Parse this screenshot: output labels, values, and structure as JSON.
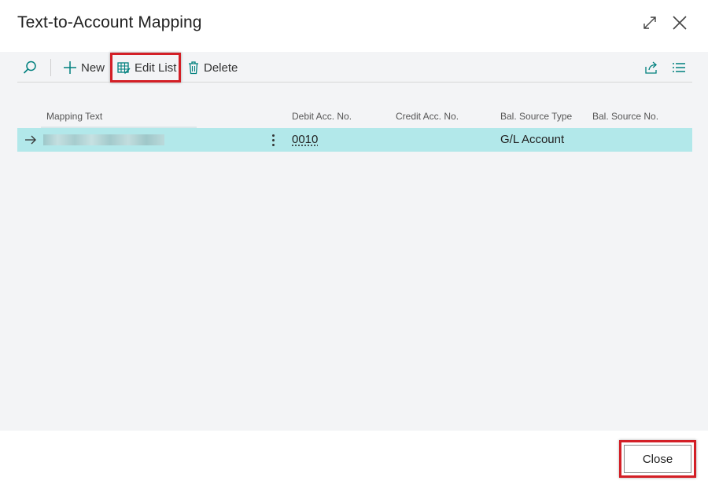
{
  "dialog": {
    "title": "Text-to-Account Mapping"
  },
  "toolbar": {
    "new_label": "New",
    "edit_list_label": "Edit List",
    "delete_label": "Delete"
  },
  "columns": [
    "Mapping Text",
    "Debit Acc. No.",
    "Credit Acc. No.",
    "Bal. Source Type",
    "Bal. Source No."
  ],
  "rows": [
    {
      "mapping_text": "",
      "debit_acc_no": "0010",
      "credit_acc_no": "",
      "bal_source_type": "G/L Account",
      "bal_source_no": ""
    }
  ],
  "footer": {
    "close_label": "Close"
  },
  "colors": {
    "accent": "#00807e",
    "selected_row": "#b2e8ea",
    "highlight": "#d31f26"
  },
  "icons": [
    "expand-icon",
    "close-icon",
    "search-icon",
    "plus-icon",
    "edit-list-icon",
    "trash-icon",
    "share-icon",
    "list-view-icon",
    "row-arrow-icon",
    "more-options-icon"
  ]
}
